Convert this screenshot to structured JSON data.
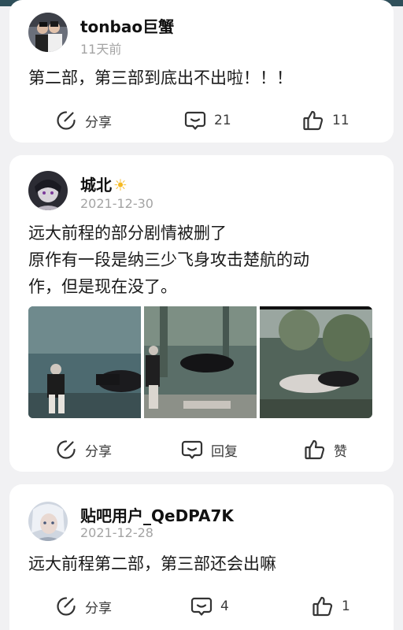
{
  "posts": [
    {
      "username": "tonbao巨蟹",
      "time": "11天前",
      "content_lines": [
        "第二部，第三部到底出不出啦！！！"
      ],
      "actions": {
        "share": "分享",
        "comment": "21",
        "like": "11"
      }
    },
    {
      "username": "城北",
      "badge_icon": "sun-emoji-icon",
      "time": "2021-12-30",
      "content_lines": [
        "远大前程的部分剧情被删了",
        "原作有一段是纳三少飞身攻击楚航的动",
        "作，但是现在没了。"
      ],
      "actions": {
        "share": "分享",
        "comment": "回复",
        "like": "赞"
      }
    },
    {
      "username": "贴吧用户_QeDPA7K",
      "time": "2021-12-28",
      "content_lines": [
        "远大前程第二部，第三部还会出嘛"
      ],
      "actions": {
        "share": "分享",
        "comment": "4",
        "like": "1"
      }
    }
  ],
  "icons": {
    "share": "edit-share-icon",
    "comment": "comment-bubble-icon",
    "like": "thumbs-up-icon"
  },
  "colors": {
    "background": "#f1f1f3",
    "card": "#ffffff",
    "timestamp": "#a4a4a4",
    "badge": "#f5b921"
  }
}
